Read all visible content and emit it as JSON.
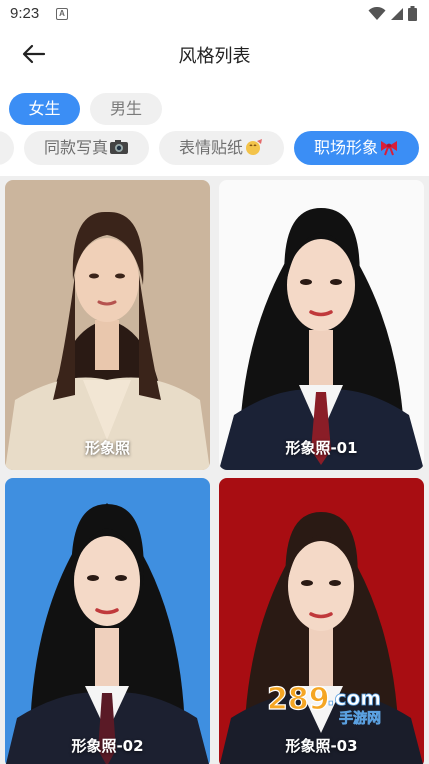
{
  "status_bar": {
    "time": "9:23",
    "a_icon": "A"
  },
  "header": {
    "title": "风格列表"
  },
  "gender_tabs": [
    {
      "label": "女生",
      "active": true
    },
    {
      "label": "男生",
      "active": false
    }
  ],
  "categories": [
    {
      "label": "同款写真",
      "icon": "camera-emoji",
      "active": false
    },
    {
      "label": "表情贴纸",
      "icon": "sticker-emoji",
      "active": false
    },
    {
      "label": "职场形象",
      "icon": "ribbon-emoji",
      "active": true
    }
  ],
  "cards": [
    {
      "label": "形象照",
      "background": "#cdb8a0"
    },
    {
      "label": "形象照-01",
      "background": "#ffffff"
    },
    {
      "label": "形象照-02",
      "background": "#3f8fe0"
    },
    {
      "label": "形象照-03",
      "background": "#a80d12"
    }
  ],
  "watermark": {
    "brand": "289",
    "suffix": ".com",
    "sub": "手游网"
  },
  "colors": {
    "accent": "#3b8ef5",
    "chip_bg": "#f0f0f0",
    "grid_bg": "#efefef"
  }
}
